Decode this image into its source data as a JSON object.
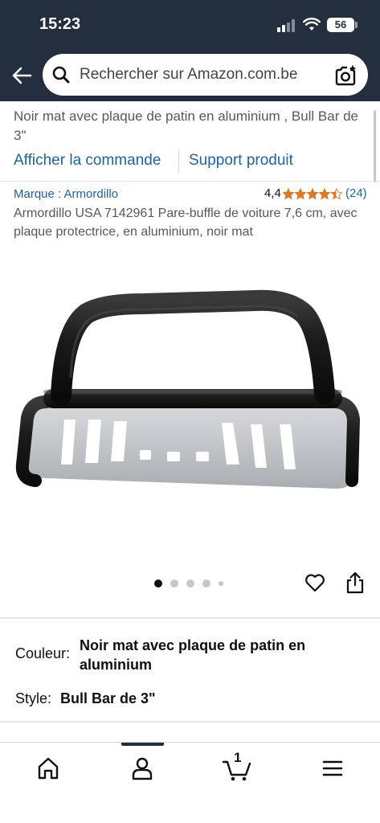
{
  "status_bar": {
    "time": "15:23",
    "battery": "56",
    "icons": [
      "signal-icon",
      "wifi-icon",
      "battery-icon"
    ]
  },
  "search": {
    "placeholder": "Rechercher sur Amazon.com.be",
    "icons": [
      "back-arrow-icon",
      "search-icon",
      "camera-search-icon"
    ]
  },
  "order_summary": {
    "title": "Noir mat avec plaque de patin en aluminium , Bull Bar de 3\"",
    "view_order_label": "Afficher la commande",
    "support_label": "Support produit"
  },
  "product": {
    "brand_link": "Marque : Armordillo",
    "rating_value": "4,4",
    "rating_stars": 4.4,
    "rating_count": "(24)",
    "title": "Armordillo USA 7142961 Pare-buffle de voiture 7,6 cm, avec plaque protectrice, en aluminium, noir mat",
    "image_icon": "bull-bar-image",
    "image_count": 5,
    "active_image_index": 0
  },
  "variations": {
    "color_label": "Couleur:",
    "color_value": "Noir mat avec plaque de patin en aluminium",
    "style_label": "Style:",
    "style_value": "Bull Bar de 3\""
  },
  "bottom_nav": {
    "cart_count": "1",
    "items": [
      "home-icon",
      "account-icon",
      "cart-icon",
      "menu-icon"
    ],
    "active_item": "account-icon"
  },
  "colors": {
    "header_bg": "#232f3e",
    "link": "#2162a1",
    "star": "#de7921",
    "text_secondary": "#565959"
  }
}
